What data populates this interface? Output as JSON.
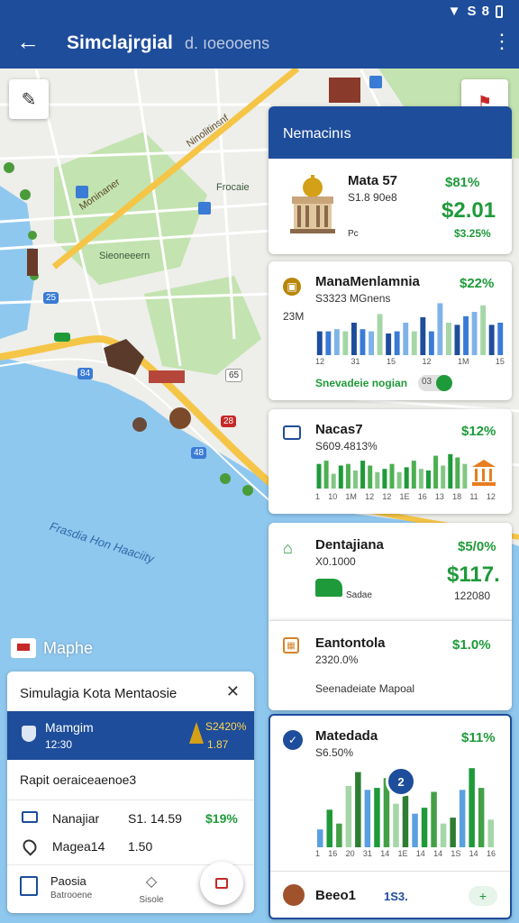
{
  "statusbar": {
    "wifi_icon": "wifi-icon",
    "text": "S 8",
    "battery_icon": "battery-icon"
  },
  "appbar": {
    "title": "Simclajrgial",
    "subtitle": "d. ıoeooens",
    "back_icon": "arrow-back-icon",
    "more_icon": "more-vert-icon"
  },
  "map": {
    "labels": {
      "park": "Sieoneeern",
      "top_street": "Frocaie",
      "road": "Moninaner",
      "mid_road": "Ninolitinsnf",
      "water": "Frasdia Hon Haaciity",
      "badge_1": "25",
      "badge_2": "84",
      "badge_3": "65",
      "badge_4": "28",
      "badge_5": "48",
      "legend": "Maphe"
    },
    "colors": {
      "land": "#eeeeea",
      "park": "#c3e3b0",
      "water": "#8fc8ef",
      "road": "#f5c547"
    }
  },
  "panel": {
    "header": "Nemacinıs",
    "card1": {
      "title": "Mata 57",
      "sub": "S1.8 90e8",
      "meta": "Pc",
      "pct_top": "$81%",
      "big": "$2.01",
      "pct_bottom": "$3.25%"
    },
    "card2": {
      "title": "ManaMenlamnia",
      "sub": "S3323 MGnens",
      "ylabel": "23M",
      "pct": "$22%",
      "x_ticks": [
        "12",
        "31",
        "15",
        "12",
        "1M",
        "15"
      ],
      "footer": "Snevadeie nogian",
      "toggle_value": "03"
    },
    "card3": {
      "title": "Nacas7",
      "sub": "S609.4813%",
      "pct": "$12%",
      "x_ticks": [
        "1",
        "10",
        "1M",
        "12",
        "12",
        "1E",
        "16",
        "13",
        "18",
        "11",
        "12"
      ]
    },
    "card4": {
      "title": "Dentajiana",
      "sub": "X0.1000",
      "pct": "$5/0%",
      "big": "$117.",
      "meta": "Sadae",
      "value": "122080"
    },
    "card5": {
      "title": "Eantontola",
      "sub": "2320.0%",
      "pct": "$1.0%",
      "footer": "Seenadeiate Mapoal"
    },
    "card6": {
      "title": "Matedada",
      "sub": "S6.50%",
      "pct": "$11%",
      "badge": "2",
      "x_ticks": [
        "1",
        "16",
        "20",
        "31",
        "14",
        "1E",
        "14",
        "14",
        "1S",
        "14",
        "16"
      ]
    },
    "card7": {
      "title": "Beeo1",
      "tag": "1S3."
    }
  },
  "bottom_card": {
    "title": "Simulagia Kota Mentaosie",
    "banner": {
      "title": "Mamgim",
      "sub": "12:30",
      "value": "S2420%",
      "value2": "1.87"
    },
    "section": "Rapit  oeraiceaenoe3",
    "rows": [
      {
        "label": "Nanajiar",
        "value": "S1. 14.59",
        "pct": "$19%"
      },
      {
        "label": "Magea14",
        "value": "1.50",
        "pct": ""
      }
    ],
    "nav": [
      {
        "label": "Paosia",
        "sub": "Batrooene"
      },
      {
        "label": "Sisole"
      }
    ]
  },
  "chart_data": [
    {
      "type": "bar",
      "title": "ManaMenlamnia",
      "ylabel": "23M",
      "x_ticks": [
        "12",
        "31",
        "15",
        "12",
        "1M",
        "15"
      ],
      "series": [
        {
          "values": [
            22,
            22,
            24,
            22,
            30,
            24,
            22,
            38,
            20,
            22,
            30,
            22,
            35,
            22,
            48,
            30,
            28,
            36,
            40,
            46,
            28,
            30
          ]
        }
      ]
    },
    {
      "type": "bar",
      "title": "Nacas7",
      "x_ticks": [
        "1",
        "10",
        "1M",
        "12",
        "12",
        "1E",
        "16",
        "13",
        "18",
        "11",
        "12"
      ],
      "series": [
        {
          "values": [
            30,
            34,
            18,
            28,
            30,
            22,
            34,
            28,
            20,
            24,
            30,
            20,
            26,
            34,
            24,
            22,
            40,
            28,
            42,
            38,
            30
          ]
        }
      ]
    },
    {
      "type": "bar",
      "title": "Matedada",
      "x_ticks": [
        "1",
        "16",
        "20",
        "31",
        "14",
        "1E",
        "14",
        "14",
        "1S",
        "14",
        "16"
      ],
      "series": [
        {
          "values": [
            18,
            38,
            24,
            62,
            76,
            58,
            60,
            70,
            44,
            52,
            34,
            40,
            56,
            24,
            30,
            58,
            80,
            60,
            28
          ]
        }
      ]
    }
  ]
}
